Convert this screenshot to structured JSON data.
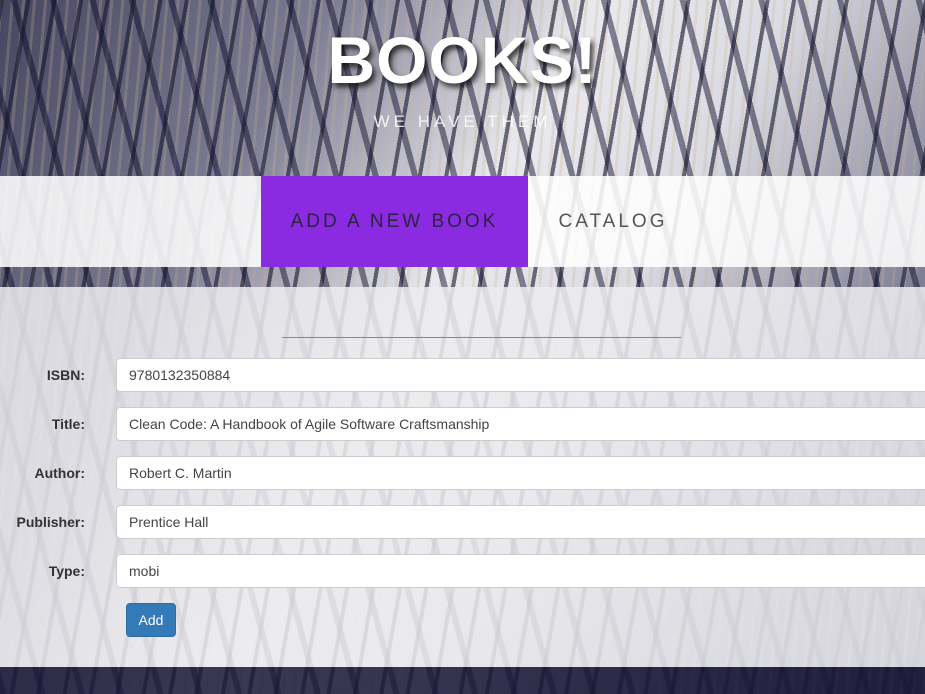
{
  "header": {
    "title": "BOOKS!",
    "subtitle": "WE HAVE THEM"
  },
  "nav": {
    "items": [
      {
        "label": "ADD A NEW BOOK",
        "active": true
      },
      {
        "label": "CATALOG",
        "active": false
      }
    ]
  },
  "form": {
    "fields": [
      {
        "label": "ISBN:",
        "value": "9780132350884"
      },
      {
        "label": "Title:",
        "value": "Clean Code: A Handbook of Agile Software Craftsmanship"
      },
      {
        "label": "Author:",
        "value": "Robert C. Martin"
      },
      {
        "label": "Publisher:",
        "value": "Prentice Hall"
      },
      {
        "label": "Type:",
        "value": "mobi"
      }
    ],
    "submit_label": "Add"
  },
  "colors": {
    "active_nav": "#8a2be2",
    "button": "#337ab7"
  }
}
